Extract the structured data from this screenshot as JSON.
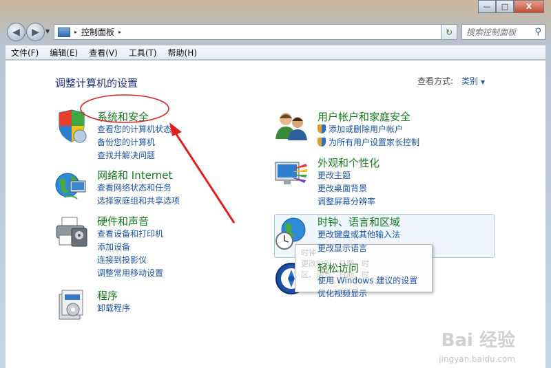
{
  "window": {
    "min": "—",
    "max": "□",
    "close": "X"
  },
  "nav": {
    "back": "◀",
    "forward": "▶",
    "drop": "▼"
  },
  "address": {
    "separator": "▸",
    "path": "控制面板",
    "dropdown": "▼",
    "refresh": "↻"
  },
  "search": {
    "placeholder": "搜索控制面板",
    "icon": "search-icon"
  },
  "menu": [
    "文件(F)",
    "编辑(E)",
    "查看(V)",
    "工具(T)",
    "帮助(H)"
  ],
  "page": {
    "title": "调整计算机的设置",
    "view_by_label": "查看方式:",
    "view_by_value": "类别",
    "view_by_arrow": "▼"
  },
  "categories": [
    {
      "title": "系统和安全",
      "icon": "system-security-shield-icon",
      "links": [
        "查看您的计算机状态",
        "备份您的计算机",
        "查找并解决问题"
      ]
    },
    {
      "title": "网络和 Internet",
      "icon": "network-globe-icon",
      "links": [
        "查看网络状态和任务",
        "选择家庭组和共享选项"
      ]
    },
    {
      "title": "硬件和声音",
      "icon": "printer-icon",
      "links": [
        "查看设备和打印机",
        "添加设备",
        "连接到投影仪",
        "调整常用移动设置"
      ]
    },
    {
      "title": "程序",
      "icon": "programs-box-icon",
      "links": [
        "卸载程序"
      ]
    },
    {
      "title": "用户帐户和家庭安全",
      "icon": "users-icon",
      "links": [
        "添加或删除用户帐户",
        "为所有用户设置家长控制"
      ]
    },
    {
      "title": "外观和个性化",
      "icon": "monitor-palette-icon",
      "links": [
        "更改主题",
        "更改桌面背景",
        "调整屏幕分辨率"
      ]
    },
    {
      "title": "时钟、语言和区域",
      "icon": "clock-globe-icon",
      "links": [
        "更改键盘或其他输入法",
        "更改显示语言"
      ]
    },
    {
      "title": "轻松访问",
      "icon": "ease-of-access-icon",
      "links": [
        "使用 Windows 建议的设置",
        "优化视频显示"
      ]
    }
  ],
  "tooltip": {
    "line1": "时钟",
    "line2": "更改时间、日期、时",
    "line3": "区、语言、日期、时"
  },
  "watermark": {
    "brand": "Bai 经验",
    "url": "jingyan.baidu.com"
  },
  "colors": {
    "title": "#1e3287",
    "category": "#167a1f",
    "link": "#1c54a6",
    "annotation": "#e02020"
  }
}
